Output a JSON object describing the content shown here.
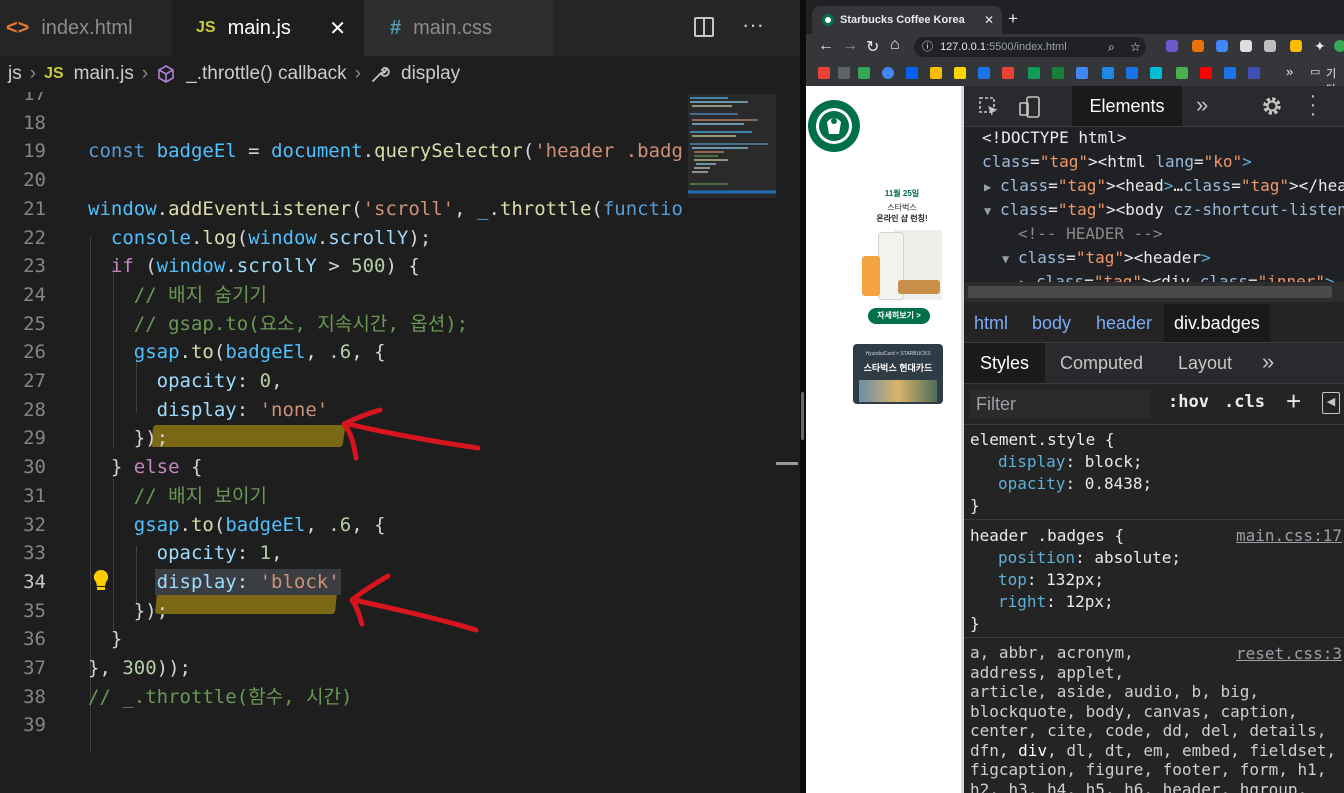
{
  "vscode": {
    "tabs": [
      {
        "icon": "<>",
        "label": "index.html",
        "active": false
      },
      {
        "icon": "JS",
        "label": "main.js",
        "active": true
      },
      {
        "icon": "#",
        "label": "main.css",
        "active": false
      }
    ],
    "close_glyph": "✕",
    "breadcrumb": {
      "folder": "js",
      "file_icon": "JS",
      "file": "main.js",
      "symbol": "_.throttle() callback",
      "member": "display"
    },
    "code_lines": [
      {
        "n": "17",
        "text": ""
      },
      {
        "n": "18",
        "text": ""
      },
      {
        "n": "19",
        "text": "const badgeEl = document.querySelector('header .badg"
      },
      {
        "n": "20",
        "text": ""
      },
      {
        "n": "21",
        "text": "window.addEventListener('scroll', _.throttle(functio"
      },
      {
        "n": "22",
        "text": "  console.log(window.scrollY);"
      },
      {
        "n": "23",
        "text": "  if (window.scrollY > 500) {"
      },
      {
        "n": "24",
        "text": "    // 배지 숨기기"
      },
      {
        "n": "25",
        "text": "    // gsap.to(요소, 지속시간, 옵션);"
      },
      {
        "n": "26",
        "text": "    gsap.to(badgeEl, .6, {"
      },
      {
        "n": "27",
        "text": "      opacity: 0,"
      },
      {
        "n": "28",
        "text": "      display: 'none'"
      },
      {
        "n": "29",
        "text": "    });"
      },
      {
        "n": "30",
        "text": "  } else {"
      },
      {
        "n": "31",
        "text": "    // 배지 보이기"
      },
      {
        "n": "32",
        "text": "    gsap.to(badgeEl, .6, {"
      },
      {
        "n": "33",
        "text": "      opacity: 1,"
      },
      {
        "n": "34",
        "text": "      display: 'block'"
      },
      {
        "n": "35",
        "text": "    });"
      },
      {
        "n": "36",
        "text": "  }"
      },
      {
        "n": "37",
        "text": "}, 300));"
      },
      {
        "n": "38",
        "text": "// _.throttle(함수, 시간)"
      },
      {
        "n": "39",
        "text": ""
      }
    ],
    "current_line": "34",
    "colors": {
      "background": "#1e1e1e",
      "highlight_marker": "#7f6d14",
      "annotation_arrow": "#d8141f"
    }
  },
  "browser": {
    "tab_title": "Starbucks Coffee Korea",
    "url_host": "127.0.0.1",
    "url_path": ":5500/index.html",
    "bookmarks_more": "»",
    "bookmarks_folder": "기타",
    "page": {
      "badge1_date": "11월 25일",
      "badge1_line1": "스타벅스",
      "badge1_line2": "온라인 샵 런칭!",
      "badge1_button": "자세히보기 >",
      "badge2_top": "HyundaiCard × STARBUCKS",
      "badge2_label": "스타벅스 현대카드"
    }
  },
  "devtools": {
    "main_tab": "Elements",
    "more_glyph": "»",
    "dom": [
      {
        "indent": 0,
        "arrow": "",
        "text": "<!DOCTYPE html>"
      },
      {
        "indent": 0,
        "arrow": "",
        "text": "<html lang=\"ko\">"
      },
      {
        "indent": 1,
        "arrow": "▶",
        "text": "<head>…</head>"
      },
      {
        "indent": 1,
        "arrow": "▼",
        "text": "<body cz-shortcut-listen=\"true\">"
      },
      {
        "indent": 2,
        "arrow": "",
        "text": "<!-- HEADER -->"
      },
      {
        "indent": 2,
        "arrow": "▼",
        "text": "<header>"
      },
      {
        "indent": 3,
        "arrow": "▶",
        "text": "<div class=\"inner\">…</div>"
      }
    ],
    "breadcrumbs": [
      "html",
      "body",
      "header",
      "div.badges"
    ],
    "subtabs": [
      "Styles",
      "Computed",
      "Layout"
    ],
    "filter_placeholder": "Filter",
    "hov": ":hov",
    "cls": ".cls",
    "rules": [
      {
        "selector": "element.style {",
        "source": "",
        "decls": [
          {
            "prop": "display",
            "val": "block;"
          },
          {
            "prop": "opacity",
            "val": "0.8438;"
          }
        ]
      },
      {
        "selector": "header .badges {",
        "source": "main.css:17",
        "decls": [
          {
            "prop": "position",
            "val": "absolute;"
          },
          {
            "prop": "top",
            "val": "132px;"
          },
          {
            "prop": "right",
            "val": "12px;"
          }
        ]
      }
    ],
    "reset_source": "reset.css:3",
    "reset_selectors": [
      "a, abbr, acronym,",
      "address, applet,",
      "article, aside, audio, b, big,",
      "blockquote, body, canvas, caption,",
      "center, cite, code, dd, del, details,",
      "dfn, div, dl, dt, em, embed, fieldset,",
      "figcaption, figure, footer, form, h1,",
      "h2, h3, h4, h5, h6, header, hgroup,"
    ]
  }
}
